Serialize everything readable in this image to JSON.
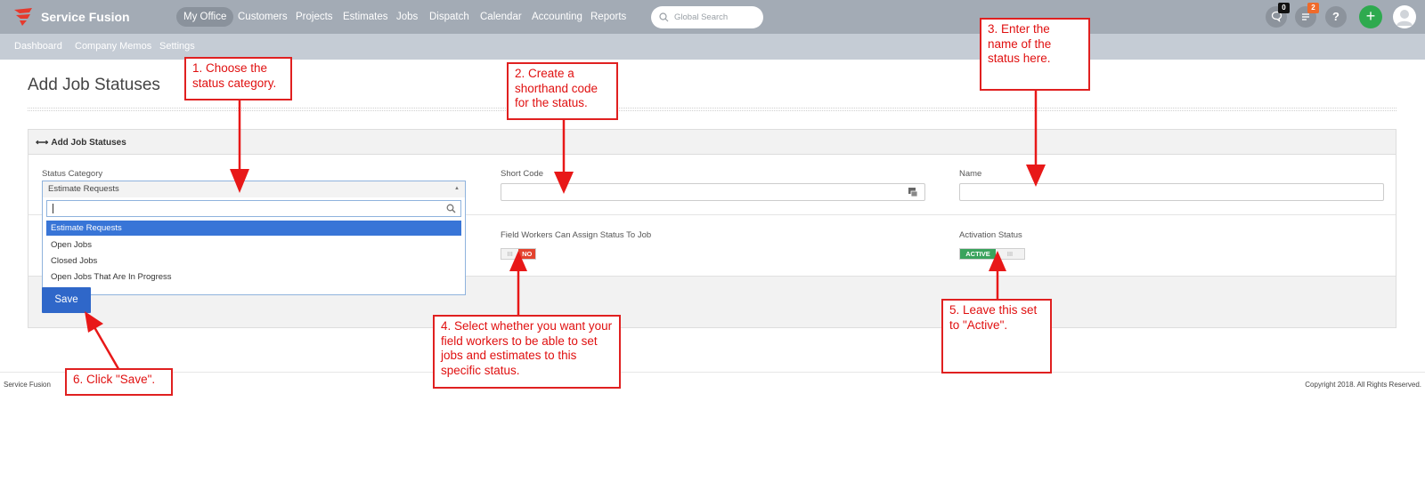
{
  "app": {
    "brand": "Service Fusion",
    "nav": [
      "My Office",
      "Customers",
      "Projects",
      "Estimates",
      "Jobs",
      "Dispatch",
      "Calendar",
      "Accounting",
      "Reports"
    ],
    "search_placeholder": "Global Search",
    "chat_badge": "0",
    "notes_badge": "2",
    "help_glyph": "?",
    "add_glyph": "+"
  },
  "subnav": [
    "Dashboard",
    "Company Memos",
    "Settings"
  ],
  "page": {
    "title": "Add Job Statuses",
    "panel_title": "Add Job Statuses"
  },
  "form": {
    "status_category_label": "Status Category",
    "status_category_value": "Estimate Requests",
    "status_category_options": [
      "Estimate Requests",
      "Open Jobs",
      "Closed Jobs",
      "Open Jobs That Are In Progress"
    ],
    "short_code_label": "Short Code",
    "name_label": "Name",
    "field_workers_label": "Field Workers Can Assign Status To Job",
    "field_workers_value": "NO",
    "activation_label": "Activation Status",
    "activation_value": "ACTIVE",
    "toggle_grip": "III",
    "save_label": "Save"
  },
  "footer": {
    "left": "Service Fusion",
    "right": "Copyright 2018. All Rights Reserved."
  },
  "annotations": [
    "1. Choose the status category.",
    "2. Create a shorthand code for the status.",
    "3. Enter the name of the status here.",
    "4. Select whether you want your field workers to be able to set jobs and estimates to this specific status.",
    "5. Leave this set to \"Active\".",
    "6. Click \"Save\"."
  ],
  "colors": {
    "topbar": "#a3abb5",
    "subbar": "#c5ccd5",
    "primary_button": "#2f67c9",
    "selected_option": "#3875d7",
    "toggle_no": "#e3432f",
    "toggle_active": "#3aa35d",
    "add_button": "#2eaa4f",
    "annotation_red": "#e01010"
  }
}
